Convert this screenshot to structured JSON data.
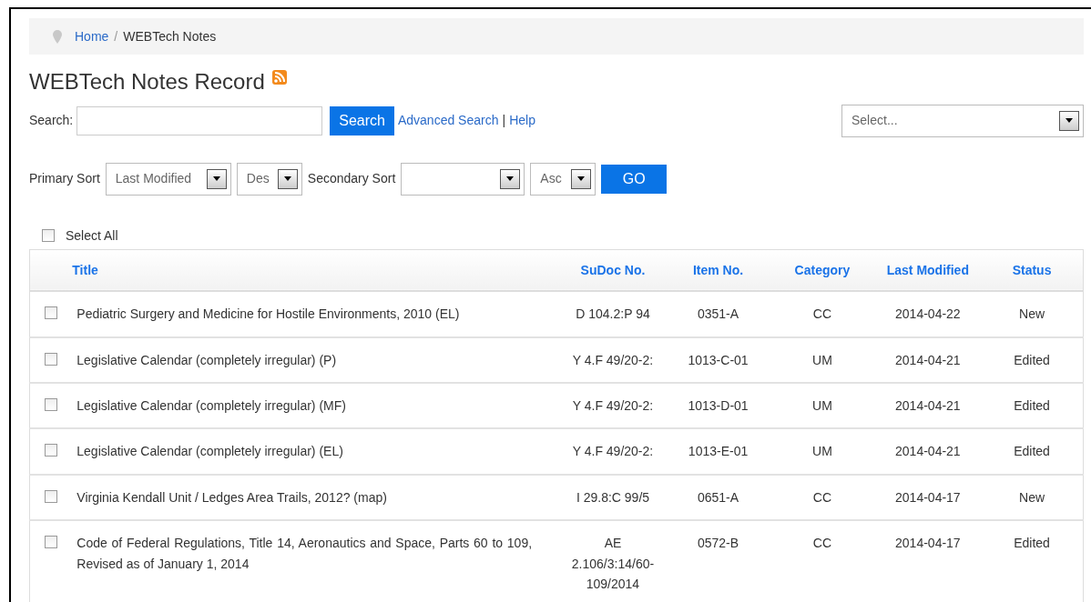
{
  "breadcrumb": [
    {
      "label": "Home",
      "kind": "link"
    },
    {
      "label": "WEBTech Notes",
      "kind": "current",
      "separator": "/"
    }
  ],
  "page_title": "WEBTech Notes Record",
  "search": {
    "label": "Search:",
    "button": "Search",
    "links": [
      {
        "label": "Advanced Search",
        "separator": "|"
      },
      {
        "label": "Help"
      }
    ],
    "filter": {
      "value": "Select..."
    }
  },
  "sort": {
    "primary_label": "Primary Sort",
    "primary_field": {
      "value": "Last Modified"
    },
    "primary_order": {
      "value": "Des"
    },
    "secondary_label": "Secondary Sort",
    "secondary_order": {
      "value": "Asc"
    },
    "button": "GO"
  },
  "select_all": {
    "label": "Select All",
    "checked": false
  },
  "table": {
    "columns": [
      "Title",
      "SuDoc No.",
      "Item No.",
      "Category",
      "Last Modified",
      "Status"
    ],
    "rows": [
      {
        "checked": false,
        "cells": [
          "Pediatric Surgery and Medicine for Hostile Environments, 2010 (EL)",
          "D 104.2:P 94",
          "0351-A",
          "CC",
          "2014-04-22",
          "New"
        ]
      },
      {
        "checked": false,
        "cells": [
          "Legislative Calendar (completely irregular) (P)",
          "Y 4.F 49/20-2:",
          "1013-C-01",
          "UM",
          "2014-04-21",
          "Edited"
        ]
      },
      {
        "checked": false,
        "cells": [
          "Legislative Calendar (completely irregular) (MF)",
          "Y 4.F 49/20-2:",
          "1013-D-01",
          "UM",
          "2014-04-21",
          "Edited"
        ]
      },
      {
        "checked": false,
        "cells": [
          "Legislative Calendar (completely irregular) (EL)",
          "Y 4.F 49/20-2:",
          "1013-E-01",
          "UM",
          "2014-04-21",
          "Edited"
        ]
      },
      {
        "checked": false,
        "cells": [
          "Virginia Kendall Unit / Ledges Area Trails, 2012? (map)",
          "I 29.8:C 99/5",
          "0651-A",
          "CC",
          "2014-04-17",
          "New"
        ]
      },
      {
        "checked": false,
        "cells": [
          "Code of Federal Regulations, Title 14, Aeronautics and Space, Parts 60 to 109, Revised as of January 1, 2014",
          "AE 2.106/3:14/60-109/2014",
          "0572-B",
          "CC",
          "2014-04-17",
          "Edited"
        ]
      }
    ]
  }
}
